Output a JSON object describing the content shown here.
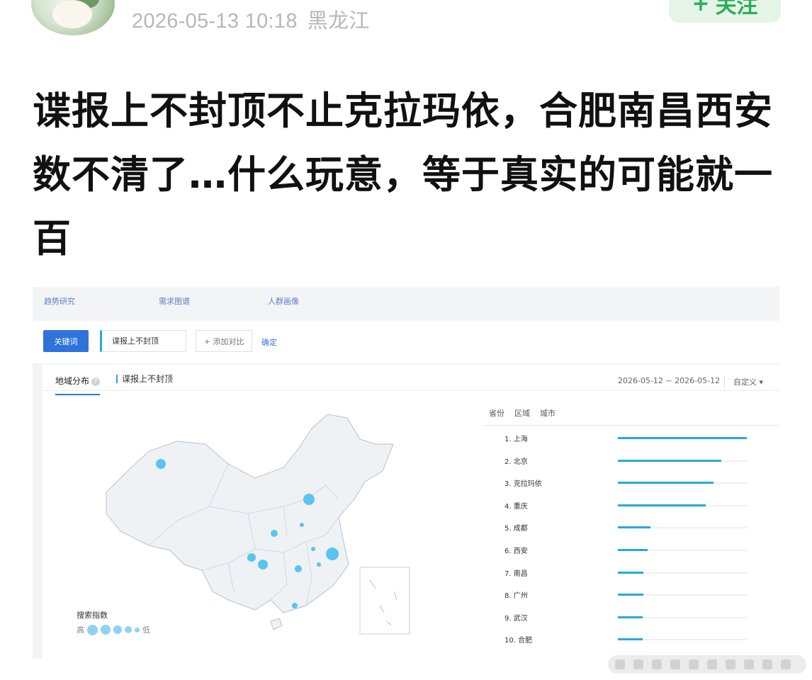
{
  "post": {
    "timestamp": "2026-05-13 10:18",
    "location": "黑龙江",
    "follow_label": "关注",
    "follow_icon": "plus-icon",
    "title": "谍报上不封顶不止克拉玛依，合肥南昌西安数不清了…什么玩意，等于真实的可能就一百"
  },
  "shot": {
    "nav": [
      "趋势研究",
      "需求图谱",
      "人群画像"
    ],
    "keyword_button": "关键词",
    "keyword_value": "谍报上不封顶",
    "add_compare": "+ 添加对比",
    "confirm": "确定",
    "tab_region": "地域分布",
    "tab_keyword": "谍报上不封顶",
    "date_range": "2026-05-12 ~ 2026-05-12",
    "custom": "自定义",
    "legend_title": "搜索指数",
    "legend_high": "高",
    "legend_low": "低",
    "rank_tabs": [
      "省份",
      "区域",
      "城市"
    ],
    "ranking": [
      {
        "label": "1.  上海",
        "value": 100
      },
      {
        "label": "2.  北京",
        "value": 80
      },
      {
        "label": "3.  克拉玛依",
        "value": 74
      },
      {
        "label": "4.  重庆",
        "value": 68
      },
      {
        "label": "5.  成都",
        "value": 25
      },
      {
        "label": "6.  西安",
        "value": 23
      },
      {
        "label": "7.  南昌",
        "value": 20
      },
      {
        "label": "8.  广州",
        "value": 20
      },
      {
        "label": "9.  武汉",
        "value": 19
      },
      {
        "label": "10. 合肥",
        "value": 19
      }
    ]
  },
  "colors": {
    "accent": "#2e73dc",
    "bar": "#29a8dd",
    "bubble": "#5cc3ee",
    "follow": "#2aae58"
  }
}
